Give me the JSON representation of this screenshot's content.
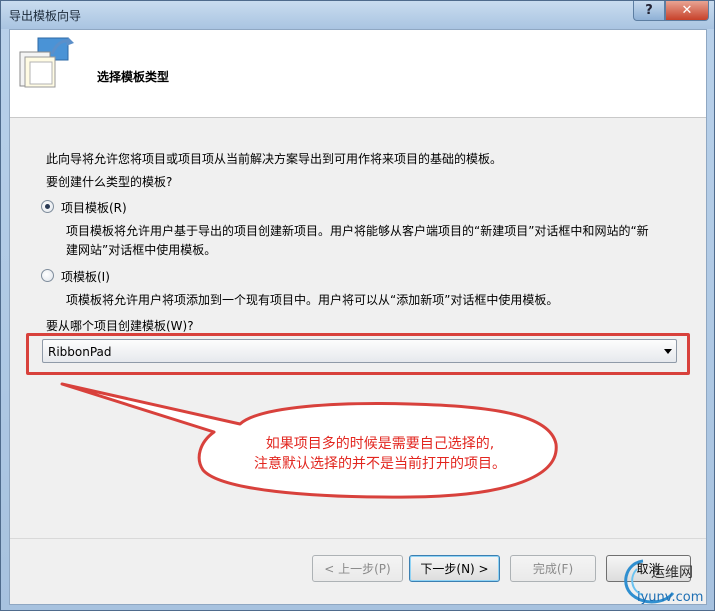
{
  "window": {
    "title": "导出模板向导",
    "help_glyph": "?",
    "close_glyph": "✕"
  },
  "header": {
    "page_title": "选择模板类型"
  },
  "content": {
    "intro": "此向导将允许您将项目或项目项从当前解决方案导出到可用作将来项目的基础的模板。",
    "question": "要创建什么类型的模板?",
    "options": [
      {
        "label": "项目模板(R)",
        "checked": true,
        "desc_line1": "项目模板将允许用户基于导出的项目创建新项目。用户将能够从客户端项目的“新建项目”对话框中和网站的“新",
        "desc_line2": "建网站”对话框中使用模板。"
      },
      {
        "label": "项模板(I)",
        "checked": false,
        "desc_line1": "项模板将允许用户将项添加到一个现有项目中。用户将可以从“添加新项”对话框中使用模板。"
      }
    ],
    "project_prompt": "要从哪个项目创建模板(W)?",
    "project_value": "RibbonPad"
  },
  "annotation": {
    "line1": "如果项目多的时候是需要自己选择的,",
    "line2": "注意默认选择的并不是当前打开的项目。",
    "color": "#e2261f"
  },
  "buttons": {
    "prev": "< 上一步(P)",
    "next": "下一步(N) >",
    "finish": "完成(F)",
    "cancel": "取消"
  },
  "watermark": {
    "brand": "运维网",
    "domain": "iyunv.com"
  }
}
